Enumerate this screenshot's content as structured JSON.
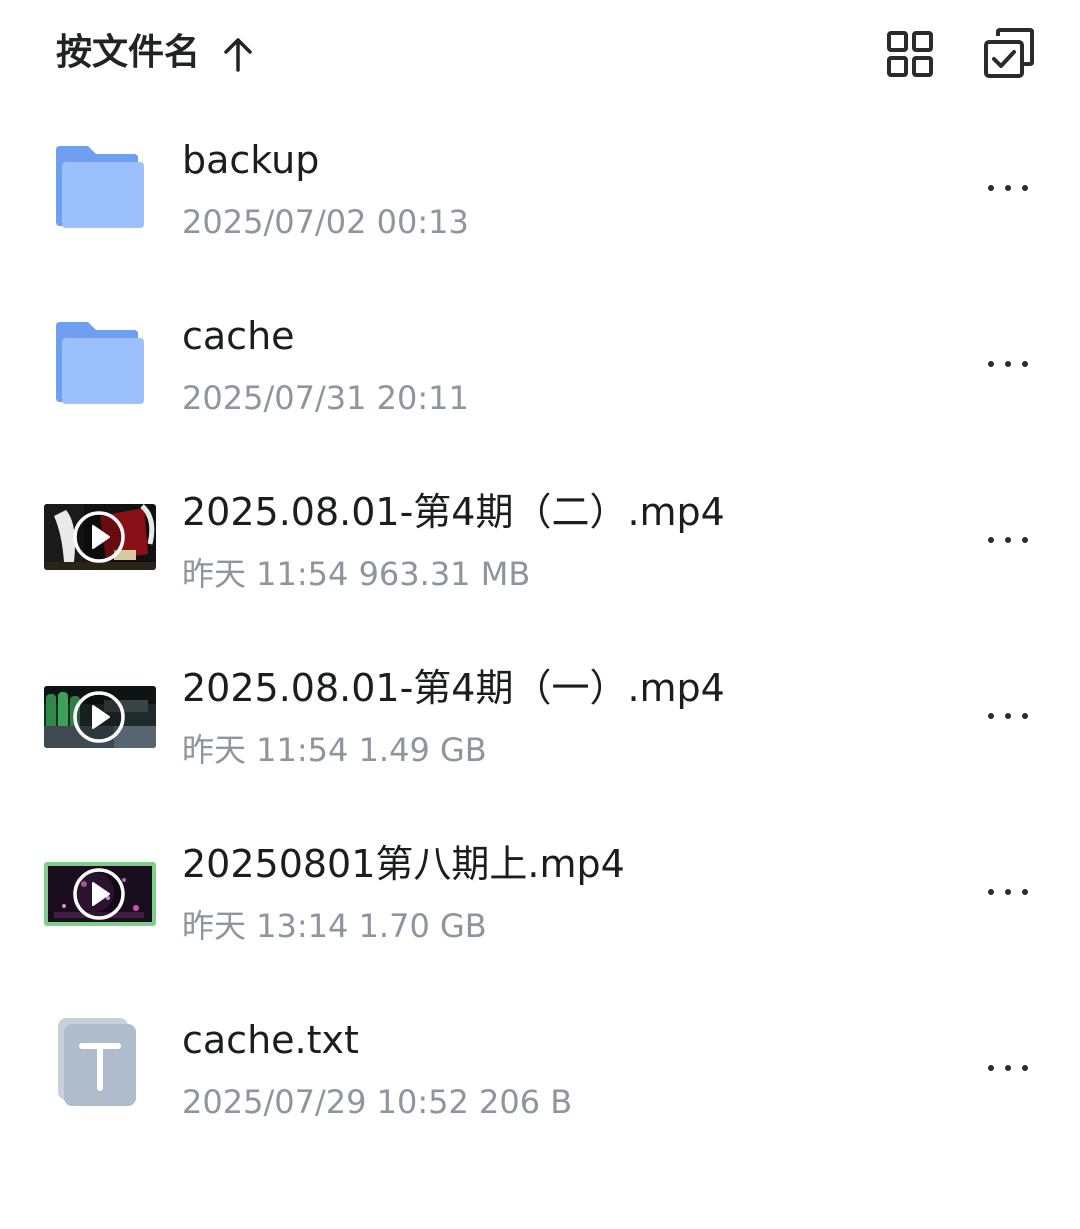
{
  "header": {
    "sort_label": "按文件名",
    "sort_direction_icon": "arrow-up-icon",
    "view_toggle_icon": "grid-view-icon",
    "multi_select_icon": "multi-select-icon"
  },
  "files": [
    {
      "type": "folder",
      "name": "backup",
      "meta": "2025/07/02 00:13"
    },
    {
      "type": "folder",
      "name": "cache",
      "meta": "2025/07/31 20:11"
    },
    {
      "type": "video",
      "name": "2025.08.01-第4期（二）.mp4",
      "meta": "昨天 11:54  963.31 MB"
    },
    {
      "type": "video",
      "name": "2025.08.01-第4期（一）.mp4",
      "meta": "昨天 11:54  1.49 GB"
    },
    {
      "type": "video",
      "name": "20250801第八期上.mp4",
      "meta": "昨天 13:14  1.70 GB"
    },
    {
      "type": "text",
      "name": "cache.txt",
      "meta": "2025/07/29 10:52  206 B"
    }
  ],
  "colors": {
    "folder": "#7aa9f5",
    "folder_light": "#9cc0fb",
    "name_text": "#1c1d20",
    "meta_text": "#8d959f",
    "icon_dark": "#2a2b2e"
  },
  "icons": {
    "more": "more-horizontal-icon",
    "folder": "folder-icon",
    "video": "play-icon",
    "text": "text-file-icon"
  }
}
